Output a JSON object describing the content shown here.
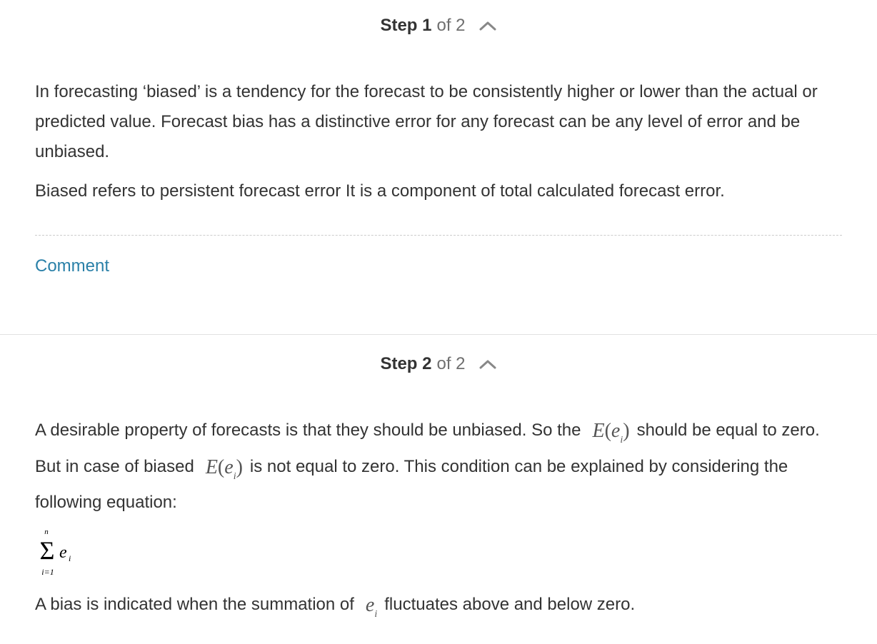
{
  "steps": [
    {
      "header": {
        "step_word": "Step",
        "step_number": "1",
        "of_text": "of 2"
      },
      "paragraphs": [
        "In forecasting ‘biased’ is a tendency for the forecast to be consistently higher or lower than the actual or predicted value. Forecast bias has a distinctive error for any forecast can be any level of error and be unbiased.",
        "Biased refers to persistent forecast error It is a component of total calculated forecast error."
      ],
      "comment_label": "Comment"
    },
    {
      "header": {
        "step_word": "Step",
        "step_number": "2",
        "of_text": "of 2"
      },
      "p1": {
        "a": "A desirable property of forecasts is that they should be unbiased. So the",
        "b": "should be equal to zero. But in case of biased",
        "c": "is not equal to zero. This condition can be explained by considering the following equation:"
      },
      "expectation": {
        "func": "E",
        "var": "e",
        "sub": "i"
      },
      "summation": {
        "upper": "n",
        "lower": "i=1",
        "term": "e",
        "sub": "i"
      },
      "p2": {
        "a": "A bias is indicated when the summation of",
        "var": "e",
        "sub": "i",
        "b": "fluctuates above and below zero."
      }
    }
  ],
  "icons": {
    "collapse": "chevron-up-icon"
  },
  "colors": {
    "link": "#2a80a8",
    "text": "#333333",
    "muted": "#6f6f6f"
  }
}
